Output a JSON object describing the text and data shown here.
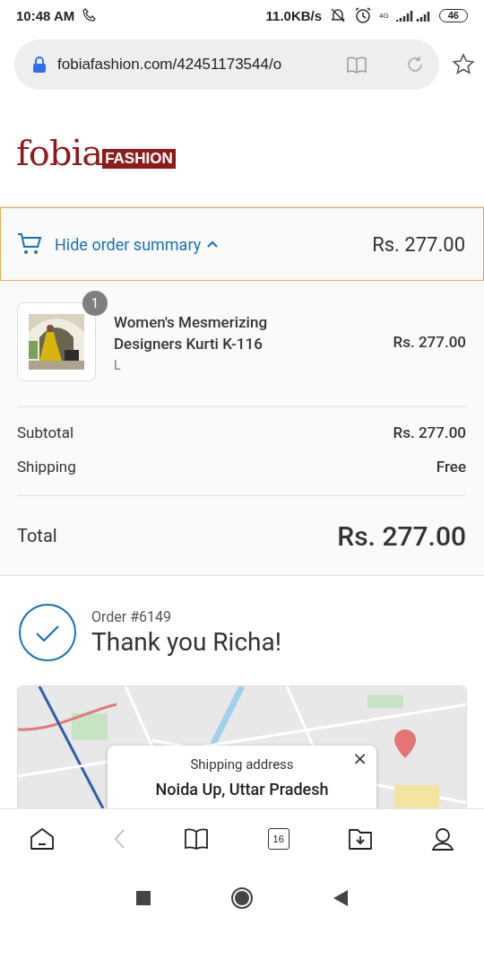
{
  "status_bar": {
    "time": "10:48 AM",
    "net_speed": "11.0KB/s",
    "network": "4G",
    "battery": "46"
  },
  "address_bar": {
    "url": "fobiafashion.com/42451173544/o"
  },
  "logo": {
    "main": "fobia",
    "tag": "FASHION"
  },
  "summary_toggle": {
    "label": "Hide order summary",
    "expanded": true,
    "total": "Rs. 277.00"
  },
  "line_items": [
    {
      "kind": "picture",
      "quantity": "1",
      "name": "Women's Mesmerizing Designers Kurti K-116",
      "variant": "L",
      "price": "Rs. 277.00"
    }
  ],
  "costs": [
    {
      "label": "Subtotal",
      "value": "Rs. 277.00"
    },
    {
      "label": "Shipping",
      "value": "Free"
    }
  ],
  "total": {
    "label": "Total",
    "value": "Rs. 277.00"
  },
  "order": {
    "number": "Order #6149",
    "thanks": "Thank you Richa!"
  },
  "map_popup": {
    "title": "Shipping address",
    "address": "Noida Up, Uttar Pradesh",
    "close": "×"
  },
  "browser_nav": {
    "tab_count": "16"
  }
}
